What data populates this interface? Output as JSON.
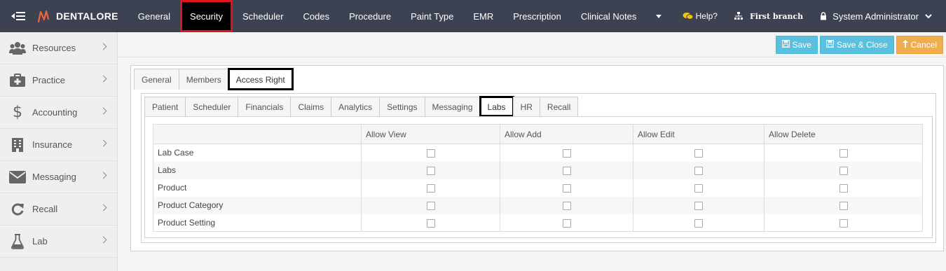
{
  "app": {
    "brand": "DENTALORE"
  },
  "topnav": {
    "items": [
      "General",
      "Security",
      "Scheduler",
      "Codes",
      "Procedure",
      "Paint Type",
      "EMR",
      "Prescription",
      "Clinical Notes"
    ],
    "active": "Security"
  },
  "topright": {
    "help": "Help?",
    "branch": "First branch",
    "user": "System Administrator"
  },
  "sidebar": {
    "items": [
      {
        "label": "Resources",
        "icon": "users-icon"
      },
      {
        "label": "Practice",
        "icon": "medical-kit-icon"
      },
      {
        "label": "Accounting",
        "icon": "dollar-icon"
      },
      {
        "label": "Insurance",
        "icon": "building-icon"
      },
      {
        "label": "Messaging",
        "icon": "envelope-icon"
      },
      {
        "label": "Recall",
        "icon": "refresh-icon"
      },
      {
        "label": "Lab",
        "icon": "flask-icon"
      }
    ]
  },
  "actions": {
    "save": "Save",
    "save_close": "Save & Close",
    "cancel": "Cancel"
  },
  "outer_tabs": {
    "items": [
      "General",
      "Members",
      "Access Right"
    ],
    "active": "Access Right"
  },
  "inner_tabs": {
    "items": [
      "Patient",
      "Scheduler",
      "Financials",
      "Claims",
      "Analytics",
      "Settings",
      "Messaging",
      "Labs",
      "HR",
      "Recall"
    ],
    "active": "Labs"
  },
  "permissions": {
    "columns": [
      "",
      "Allow View",
      "Allow Add",
      "Allow Edit",
      "Allow Delete"
    ],
    "rows": [
      {
        "label": "Lab Case",
        "view": false,
        "add": false,
        "edit": false,
        "delete": false
      },
      {
        "label": "Labs",
        "view": false,
        "add": false,
        "edit": false,
        "delete": false
      },
      {
        "label": "Product",
        "view": false,
        "add": false,
        "edit": false,
        "delete": false
      },
      {
        "label": "Product Category",
        "view": false,
        "add": false,
        "edit": false,
        "delete": false
      },
      {
        "label": "Product Setting",
        "view": false,
        "add": false,
        "edit": false,
        "delete": false
      }
    ]
  },
  "colors": {
    "topbar": "#3c4252",
    "active_tab_outline": "#e0141c",
    "info_button": "#5bc0de",
    "warning_button": "#f0ad4e",
    "logo_accent": "#f0643c"
  }
}
